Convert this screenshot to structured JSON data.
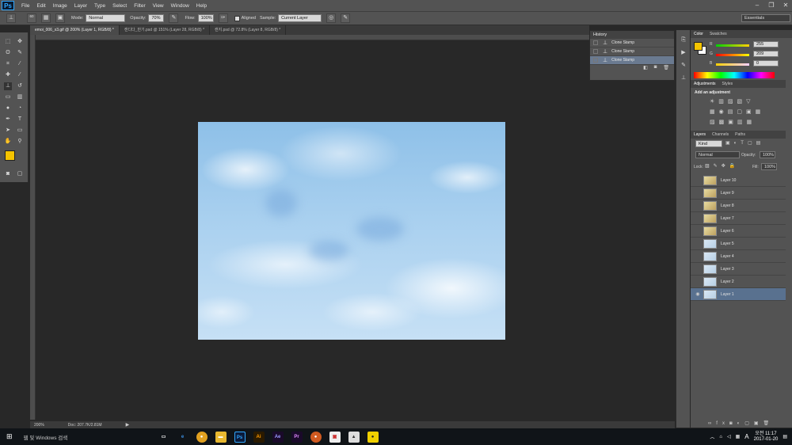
{
  "app": {
    "logo": "Ps"
  },
  "menu": [
    "File",
    "Edit",
    "Image",
    "Layer",
    "Type",
    "Select",
    "Filter",
    "View",
    "Window",
    "Help"
  ],
  "window_controls": [
    "–",
    "❐",
    "✕"
  ],
  "options": {
    "mode_label": "Mode:",
    "mode_value": "Normal",
    "opacity_label": "Opacity:",
    "opacity_value": "70%",
    "flow_label": "Flow:",
    "flow_value": "100%",
    "aligned_label": "Aligned",
    "sample_label": "Sample:",
    "sample_value": "Current Layer",
    "brush_size": "60",
    "workspace": "Essentials"
  },
  "tabs": [
    {
      "label": "emoi_006_x3.gif @ 200% (Layer 1, RGB/8) *",
      "active": true
    },
    {
      "label": "캔디다_만기.psd @ 151% (Layer 28, RGB/8) *",
      "active": false
    },
    {
      "label": "캔지.psd @ 72.8% (Layer 8, RGB/8) *",
      "active": false
    }
  ],
  "status": {
    "zoom": "200%",
    "doc": "Doc: 207.7K/2.81M"
  },
  "history": {
    "title": "History",
    "items": [
      "Clone Stamp",
      "Clone Stamp",
      "Clone Stamp"
    ],
    "selected_index": 2
  },
  "color_panel": {
    "tabs": [
      "Color",
      "Swatches"
    ],
    "r_label": "R",
    "g_label": "G",
    "b_label": "B",
    "r": "255",
    "g": "209",
    "b": "0",
    "fg_color": "#f5c400",
    "bg_color": "#ffffff"
  },
  "adjustments": {
    "tabs": [
      "Adjustments",
      "Styles"
    ],
    "heading": "Add an adjustment"
  },
  "layers_panel": {
    "tabs": [
      "Layers",
      "Channels",
      "Paths"
    ],
    "kind": "Kind",
    "blend": "Normal",
    "opacity_label": "Opacity:",
    "opacity": "100%",
    "lock_label": "Lock:",
    "fill_label": "Fill:",
    "fill": "100%",
    "layers": [
      {
        "name": "Layer 10",
        "visible": false,
        "active": false
      },
      {
        "name": "Layer 9",
        "visible": false,
        "active": false
      },
      {
        "name": "Layer 8",
        "visible": false,
        "active": false
      },
      {
        "name": "Layer 7",
        "visible": false,
        "active": false
      },
      {
        "name": "Layer 6",
        "visible": false,
        "active": false
      },
      {
        "name": "Layer 5",
        "visible": false,
        "active": false
      },
      {
        "name": "Layer 4",
        "visible": false,
        "active": false
      },
      {
        "name": "Layer 3",
        "visible": false,
        "active": false
      },
      {
        "name": "Layer 2",
        "visible": false,
        "active": false
      },
      {
        "name": "Layer 1",
        "visible": true,
        "active": true
      }
    ]
  },
  "taskbar": {
    "search_placeholder": "웹 및 Windows 검색",
    "time": "오전 11:17",
    "date": "2017-01-20",
    "ime": "A"
  }
}
